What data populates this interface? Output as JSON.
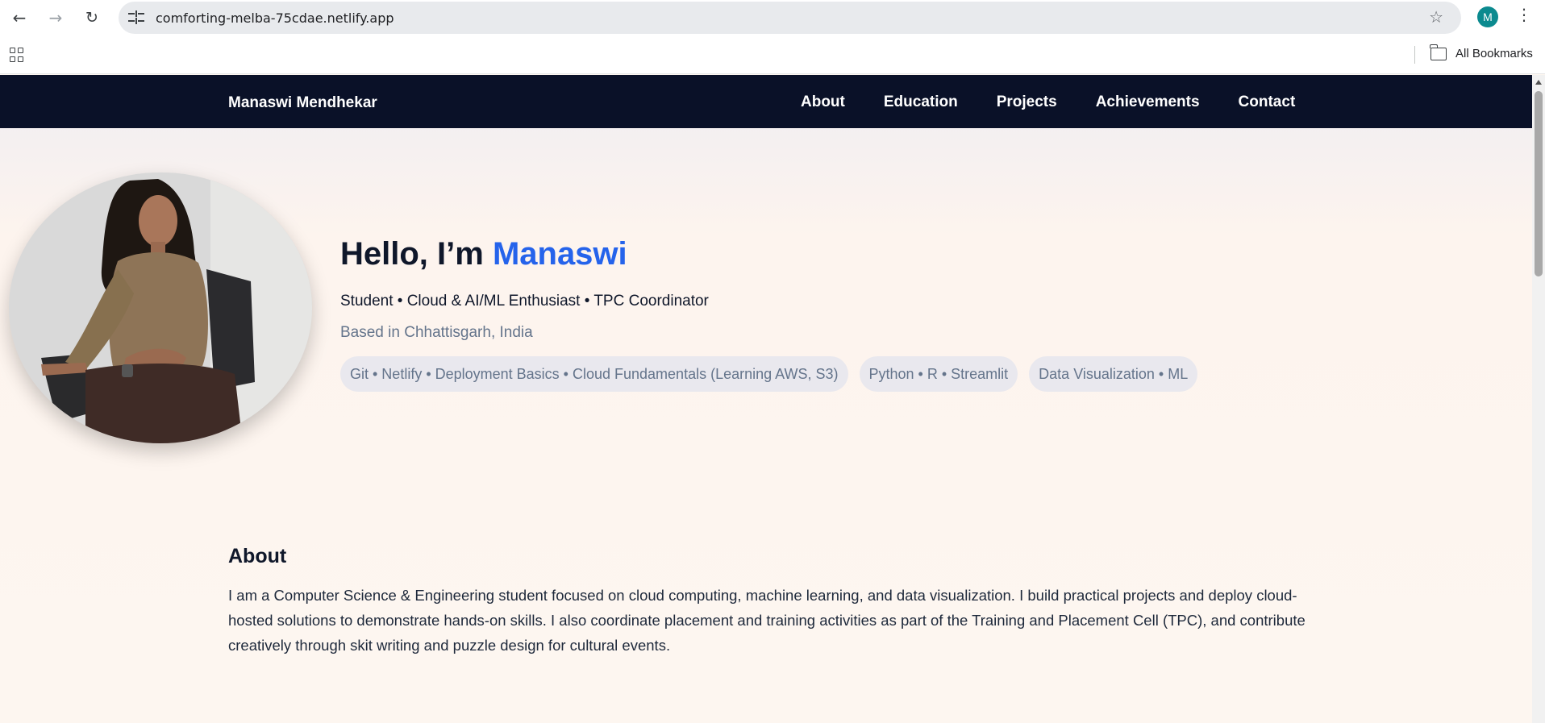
{
  "browser": {
    "url": "comforting-melba-75cdae.netlify.app",
    "profile_initial": "M",
    "bookmarks_label": "All Bookmarks"
  },
  "nav": {
    "brand": "Manaswi Mendhekar",
    "links": [
      "About",
      "Education",
      "Projects",
      "Achievements",
      "Contact"
    ]
  },
  "hero": {
    "greeting": "Hello, I’m ",
    "name": "Manaswi",
    "subtitle": "Student • Cloud & AI/ML Enthusiast • TPC Coordinator",
    "location": "Based in Chhattisgarh, India",
    "chips": [
      "Git • Netlify • Deployment Basics • Cloud Fundamentals (Learning AWS, S3)",
      "Python • R • Streamlit",
      "Data Visualization • ML"
    ]
  },
  "about": {
    "title": "About",
    "text": "I am a Computer Science & Engineering student focused on cloud computing, machine learning, and data visualization. I build practical projects and deploy cloud-hosted solutions to demonstrate hands-on skills. I also coordinate placement and training activities as part of the Training and Placement Cell (TPC), and contribute creatively through skit writing and puzzle design for cultural events."
  },
  "colors": {
    "nav_bg": "#0a1128",
    "accent": "#2563eb",
    "muted": "#64748b",
    "chip_bg": "#e9e8ee"
  },
  "icons": [
    "back-arrow-icon",
    "forward-arrow-icon",
    "reload-icon",
    "site-info-icon",
    "bookmark-star-icon",
    "kebab-menu-icon",
    "apps-grid-icon",
    "folder-icon"
  ]
}
